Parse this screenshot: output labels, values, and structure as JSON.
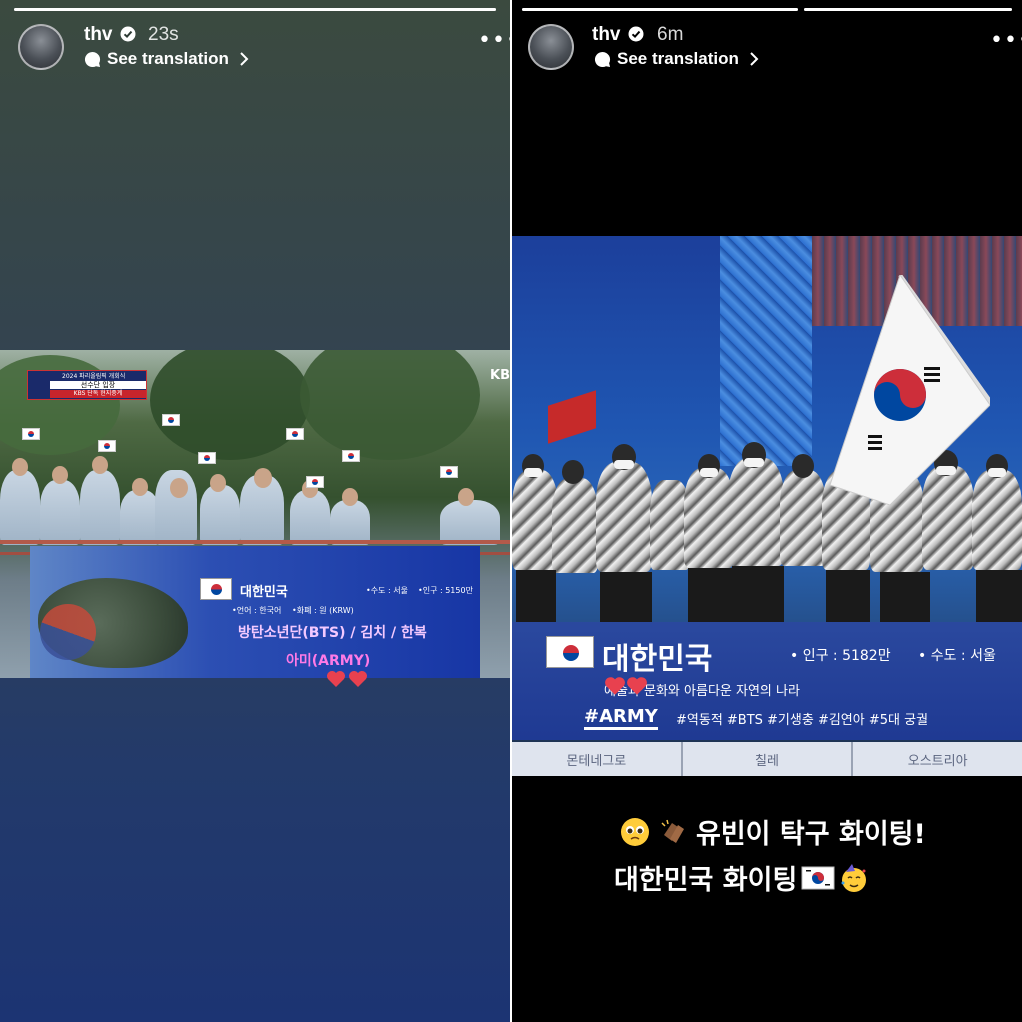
{
  "stories": [
    {
      "username": "thv",
      "time_ago": "23s",
      "see_translation": "See translation",
      "progress": [
        1.0
      ]
    },
    {
      "username": "thv",
      "time_ago": "6m",
      "see_translation": "See translation",
      "progress": [
        1.0,
        1.0
      ]
    }
  ],
  "left_broadcast": {
    "banner_line1": "2024 파리올림픽 개회식",
    "banner_line2": "선수단 입장",
    "banner_line3": "KBS 단독 현지중계",
    "channel": "KB",
    "country": "대한민국",
    "capital": "•수도 : 서울",
    "population": "•인구 : 5150만",
    "language": "•언어 : 한국어",
    "currency": "•화폐 : 원 (KRW)",
    "keywords_line1": "방탄소년단(BTS) / 김치 / 한복",
    "keywords_line2": "아미(ARMY)"
  },
  "right_broadcast": {
    "country": "대한민국",
    "population": "• 인구 : 5182만",
    "capital": "• 수도 : 서울",
    "description": "예술과 문화와 아름다운 자연의 나라",
    "army_tag": "#ARMY",
    "tags": "#역동적 #BTS #기생충 #김연아 #5대 궁궐",
    "next_countries": [
      "몬테네그로",
      "칠레",
      "오스트리아"
    ]
  },
  "caption": {
    "line1": "유빈이 탁구 화이팅!",
    "line2": "대한민국 화이팅"
  },
  "colors": {
    "accent_pink": "#ff7ae6",
    "heart_red": "#e8414f",
    "korea_red": "#cd2e3a",
    "korea_blue": "#0047a0"
  }
}
